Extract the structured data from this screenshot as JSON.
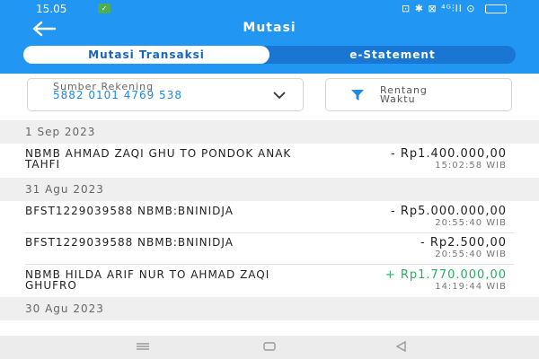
{
  "status_bar": {
    "time": "15.05",
    "badge": "✓",
    "right_icons": "⊡ ✱ ⊠ ⁴ᴳ⫶ll ⊙"
  },
  "header": {
    "title": "Mutasi"
  },
  "tabs": [
    {
      "label": "Mutasi Transaksi",
      "active": true
    },
    {
      "label": "e-Statement",
      "active": false
    }
  ],
  "account": {
    "label": "Sumber Rekening",
    "number": "5882 0101 4769 538"
  },
  "date_filter": {
    "label": "Rentang Waktu"
  },
  "groups": [
    {
      "date": "1 Sep 2023",
      "transactions": [
        {
          "description": "NBMB AHMAD ZAQI GHU TO PONDOK ANAK TAHFI",
          "amount": "- Rp1.400.000,00",
          "time": "15:02:58 WIB",
          "type": "debit"
        }
      ]
    },
    {
      "date": "31 Agu 2023",
      "transactions": [
        {
          "description": "BFST1229039588 NBMB:BNINIDJA",
          "amount": "- Rp5.000.000,00",
          "time": "20:55:40 WIB",
          "type": "debit"
        },
        {
          "description": "BFST1229039588 NBMB:BNINIDJA",
          "amount": "- Rp2.500,00",
          "time": "20:55:40 WIB",
          "type": "debit"
        },
        {
          "description": "NBMB HILDA ARIF NUR TO AHMAD ZAQI GHUFRO",
          "amount": "+ Rp1.770.000,00",
          "time": "14:19:44 WIB",
          "type": "credit"
        }
      ]
    },
    {
      "date": "30 Agu 2023",
      "transactions": []
    }
  ],
  "colors": {
    "primary": "#2196f3",
    "credit": "#27ae60",
    "account_number": "#1e88e5"
  },
  "icons": {
    "back": "arrow-left-icon",
    "chevron": "chevron-down-icon",
    "filter": "filter-icon"
  }
}
